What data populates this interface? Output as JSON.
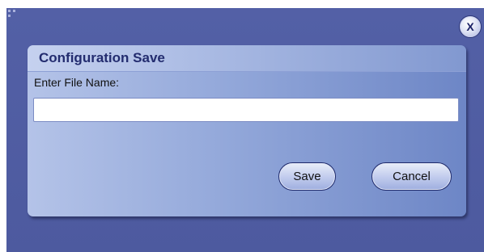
{
  "window": {
    "close_label": "X"
  },
  "dialog": {
    "title": "Configuration Save",
    "field_label": "Enter File Name:",
    "file_name_value": "",
    "file_name_placeholder": "",
    "save_label": "Save",
    "cancel_label": "Cancel"
  },
  "colors": {
    "backdrop": "#5360a6",
    "title_text": "#232c6f",
    "button_border": "#1f2a6b"
  },
  "icons": {
    "close": "close-icon",
    "grip": "resize-grip-icon"
  }
}
